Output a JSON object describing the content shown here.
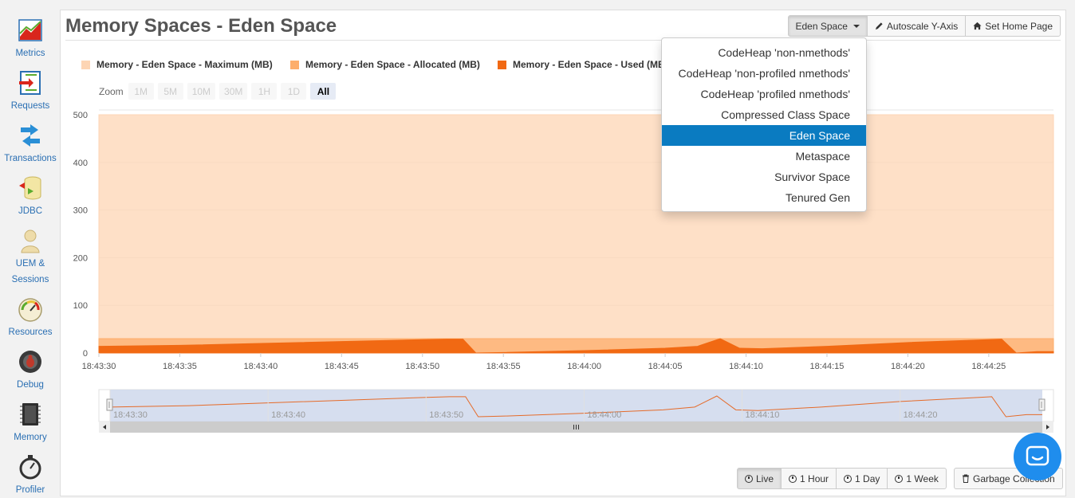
{
  "sidebar": {
    "items": [
      {
        "label": "Metrics",
        "icon": "metrics-chart-icon"
      },
      {
        "label": "Requests",
        "icon": "requests-icon"
      },
      {
        "label": "Transactions",
        "icon": "transactions-arrows-icon"
      },
      {
        "label": "JDBC",
        "icon": "jdbc-database-icon"
      },
      {
        "label": "UEM &",
        "label2": "Sessions",
        "icon": "user-icon"
      },
      {
        "label": "Resources",
        "icon": "gauge-icon"
      },
      {
        "label": "Debug",
        "icon": "bug-icon"
      },
      {
        "label": "Memory",
        "icon": "memory-chip-icon"
      },
      {
        "label": "Profiler",
        "icon": "stopwatch-icon"
      }
    ]
  },
  "header": {
    "title": "Memory Spaces - Eden Space",
    "space_select_label": "Eden Space",
    "autoscale_label": "Autoscale Y-Axis",
    "home_label": "Set Home Page"
  },
  "legend": {
    "items": [
      {
        "label": "Memory - Eden Space - Maximum (MB)",
        "color": "#fdd5b4"
      },
      {
        "label": "Memory - Eden Space - Allocated (MB)",
        "color": "#fdae6b"
      },
      {
        "label": "Memory - Eden Space - Used (MB)",
        "color": "#f16913"
      }
    ]
  },
  "zoom": {
    "label": "Zoom",
    "buttons": [
      "1M",
      "5M",
      "10M",
      "30M",
      "1H",
      "1D",
      "All"
    ],
    "active": "All"
  },
  "dropdown": {
    "options": [
      "CodeHeap 'non-nmethods'",
      "CodeHeap 'non-profiled nmethods'",
      "CodeHeap 'profiled nmethods'",
      "Compressed Class Space",
      "Eden Space",
      "Metaspace",
      "Survivor Space",
      "Tenured Gen"
    ],
    "selected": "Eden Space"
  },
  "chart_data": {
    "type": "area",
    "y_ticks": [
      0,
      100,
      200,
      300,
      400,
      500
    ],
    "ylim": [
      0,
      510
    ],
    "x_ticks": [
      "18:43:30",
      "18:43:35",
      "18:43:40",
      "18:43:45",
      "18:43:50",
      "18:43:55",
      "18:44:00",
      "18:44:05",
      "18:44:10",
      "18:44:15",
      "18:44:20",
      "18:44:25"
    ],
    "x_tick_seconds": [
      0,
      5,
      10,
      15,
      20,
      25,
      30,
      35,
      40,
      45,
      50,
      55
    ],
    "x_range_seconds": [
      0,
      59
    ],
    "navigator_ticks": [
      "18:43:30",
      "18:43:40",
      "18:43:50",
      "18:44:00",
      "18:44:10",
      "18:44:20"
    ],
    "navigator_tick_seconds": [
      0,
      10,
      20,
      30,
      40,
      50
    ],
    "series": [
      {
        "name": "Memory - Eden Space - Maximum (MB)",
        "color": "#fdd5b4",
        "points": [
          [
            0,
            500
          ],
          [
            59,
            500
          ]
        ]
      },
      {
        "name": "Memory - Eden Space - Allocated (MB)",
        "color": "#fdae6b",
        "points": [
          [
            0,
            30
          ],
          [
            59,
            30
          ]
        ]
      },
      {
        "name": "Memory - Eden Space - Used (MB)",
        "color": "#f16913",
        "points": [
          [
            0,
            14
          ],
          [
            5,
            16
          ],
          [
            10,
            20
          ],
          [
            15,
            24
          ],
          [
            20,
            28
          ],
          [
            21.5,
            29
          ],
          [
            22.5,
            29
          ],
          [
            23.3,
            0
          ],
          [
            25,
            1
          ],
          [
            30,
            5
          ],
          [
            35,
            10
          ],
          [
            37,
            14
          ],
          [
            38.4,
            30
          ],
          [
            39.6,
            10
          ],
          [
            41,
            9
          ],
          [
            45,
            14
          ],
          [
            50,
            22
          ],
          [
            55,
            28
          ],
          [
            55.8,
            29
          ],
          [
            56.7,
            0
          ],
          [
            58,
            3
          ],
          [
            59,
            3
          ]
        ]
      }
    ]
  },
  "bottom": {
    "live": "Live",
    "hour": "1 Hour",
    "day": "1 Day",
    "week": "1 Week",
    "gc": "Garbage Collection"
  }
}
